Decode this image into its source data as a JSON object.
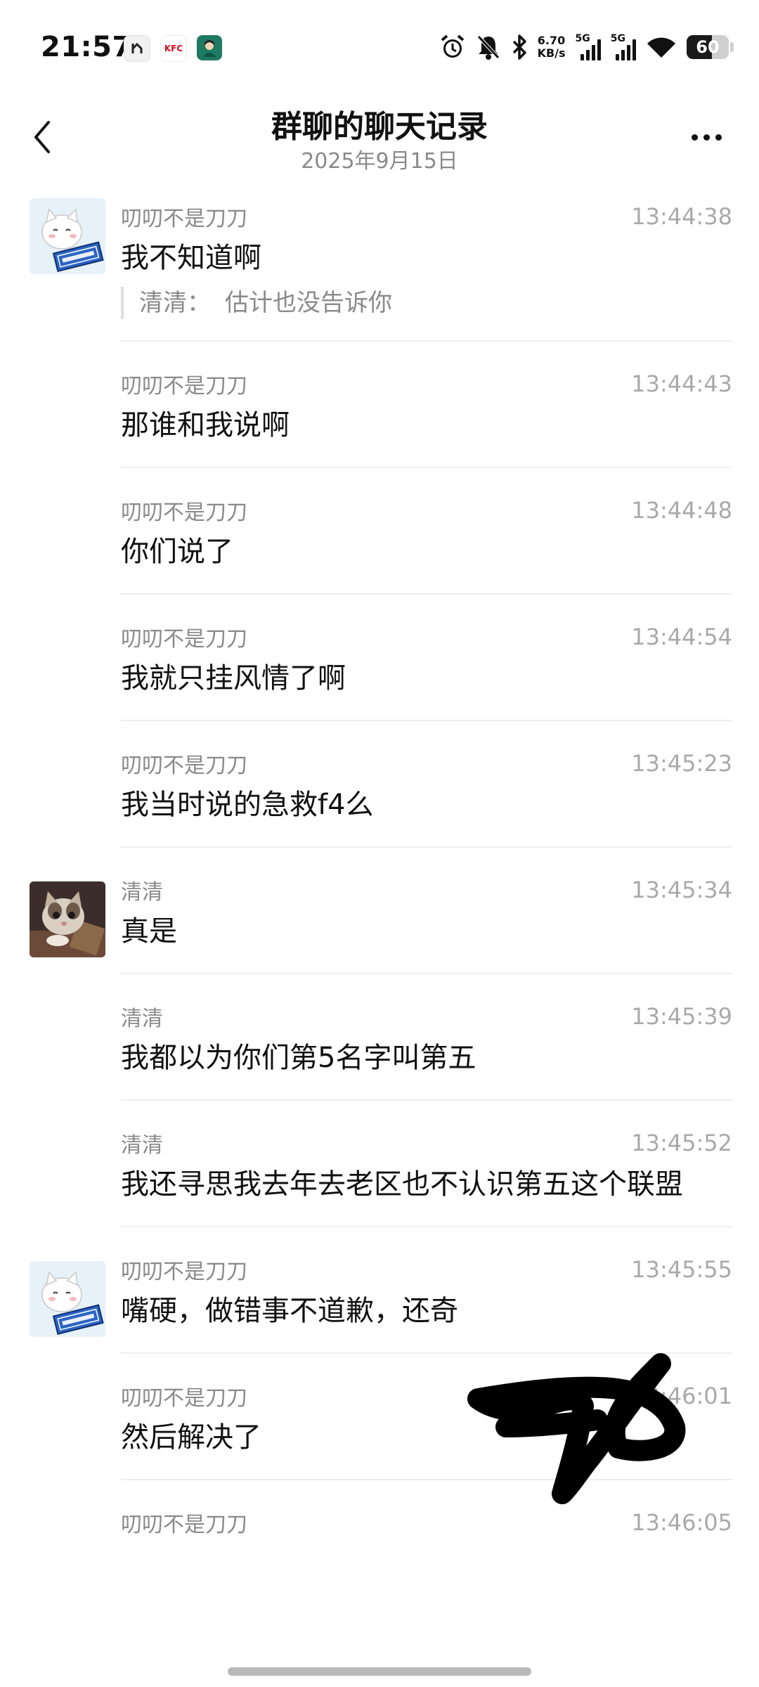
{
  "status_bar": {
    "time": "21:57",
    "app_icons": [
      "ol-icon",
      "KFC",
      "avatar-app-icon"
    ],
    "net_speed": "6.70",
    "net_speed_unit": "KB/s",
    "signal1_label": "5G",
    "signal2_label": "5G",
    "battery": "60",
    "battery_level": 0.6
  },
  "header": {
    "title": "群聊的聊天记录",
    "subtitle": "2025年9月15日"
  },
  "messages": [
    {
      "sender": "叨叨不是刀刀",
      "time": "13:44:38",
      "text": "我不知道啊",
      "quote_sender": "清清：",
      "quote_text": "估计也没告诉你"
    },
    {
      "sender": "叨叨不是刀刀",
      "time": "13:44:43",
      "text": "那谁和我说啊"
    },
    {
      "sender": "叨叨不是刀刀",
      "time": "13:44:48",
      "text": "你们说了"
    },
    {
      "sender": "叨叨不是刀刀",
      "time": "13:44:54",
      "text": "我就只挂风情了啊"
    },
    {
      "sender": "叨叨不是刀刀",
      "time": "13:45:23",
      "text": "我当时说的急救f4么"
    },
    {
      "sender": "清清",
      "time": "13:45:34",
      "text": "真是"
    },
    {
      "sender": "清清",
      "time": "13:45:39",
      "text": "我都以为你们第5名字叫第五"
    },
    {
      "sender": "清清",
      "time": "13:45:52",
      "text": "我还寻思我去年去老区也不认识第五这个联盟"
    },
    {
      "sender": "叨叨不是刀刀",
      "time": "13:45:55",
      "text": "嘴硬，做错事不道歉，还奇"
    },
    {
      "sender": "叨叨不是刀刀",
      "time": "13:46:01",
      "text": "然后解决了"
    },
    {
      "sender": "叨叨不是刀刀",
      "time": "13:46:05",
      "text": ""
    }
  ]
}
